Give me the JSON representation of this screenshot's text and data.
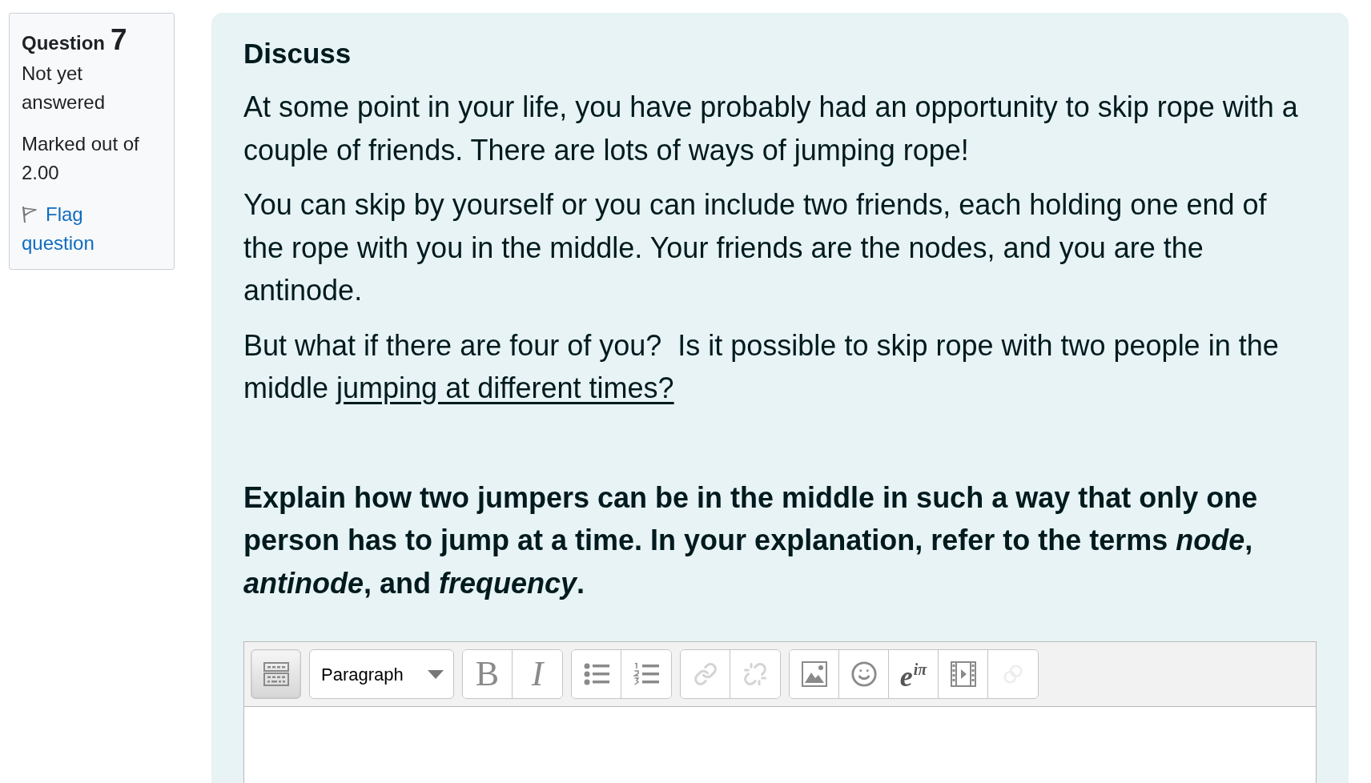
{
  "question_info": {
    "title": "Question",
    "number": "7",
    "status": "Not yet answered",
    "mark": "Marked out of 2.00",
    "flag": {
      "label": "Flag question",
      "flagged": false
    }
  },
  "question": {
    "heading": "Discuss",
    "paragraphs": [
      {
        "text": "At some point in your life, you have probably had an opportunity to skip rope with a couple of friends. There are lots of ways of jumping rope!"
      },
      {
        "text": "You can skip by yourself or you can include two friends, each holding one end of the rope with you in the middle. Your friends are the nodes, and you are the antinode."
      },
      {
        "text": "But what if there are four of you?  Is it possible to skip rope with two people in the middle ",
        "underlined": "jumping at different times?"
      }
    ],
    "prompt": "Explain how two jumpers can be in the middle in such a way that only one person has to jump at a time. In your explanation, refer to the terms *node*, *antinode*, and *frequency*."
  },
  "editor": {
    "toolbar": [
      [
        {
          "kind": "collapse",
          "pressed": true,
          "disabled": false
        }
      ],
      [
        {
          "kind": "select",
          "value": "Paragraph",
          "pressed": false,
          "disabled": false
        }
      ],
      [
        {
          "kind": "bold",
          "label": "B",
          "pressed": false,
          "disabled": false
        },
        {
          "kind": "italic",
          "label": "I",
          "pressed": false,
          "disabled": false
        }
      ],
      [
        {
          "kind": "bullet_list",
          "pressed": false,
          "disabled": false
        },
        {
          "kind": "numbered_list",
          "pressed": false,
          "disabled": false
        }
      ],
      [
        {
          "kind": "link",
          "pressed": false,
          "disabled": true
        },
        {
          "kind": "unlink",
          "pressed": false,
          "disabled": true
        }
      ],
      [
        {
          "kind": "image",
          "pressed": false,
          "disabled": false
        },
        {
          "kind": "emoji",
          "pressed": false,
          "disabled": false
        },
        {
          "kind": "equation",
          "label": "e$^{iπ}$",
          "pressed": false,
          "disabled": false
        },
        {
          "kind": "media",
          "pressed": false,
          "disabled": false
        },
        {
          "kind": "files",
          "pressed": false,
          "disabled": true
        }
      ]
    ]
  }
}
